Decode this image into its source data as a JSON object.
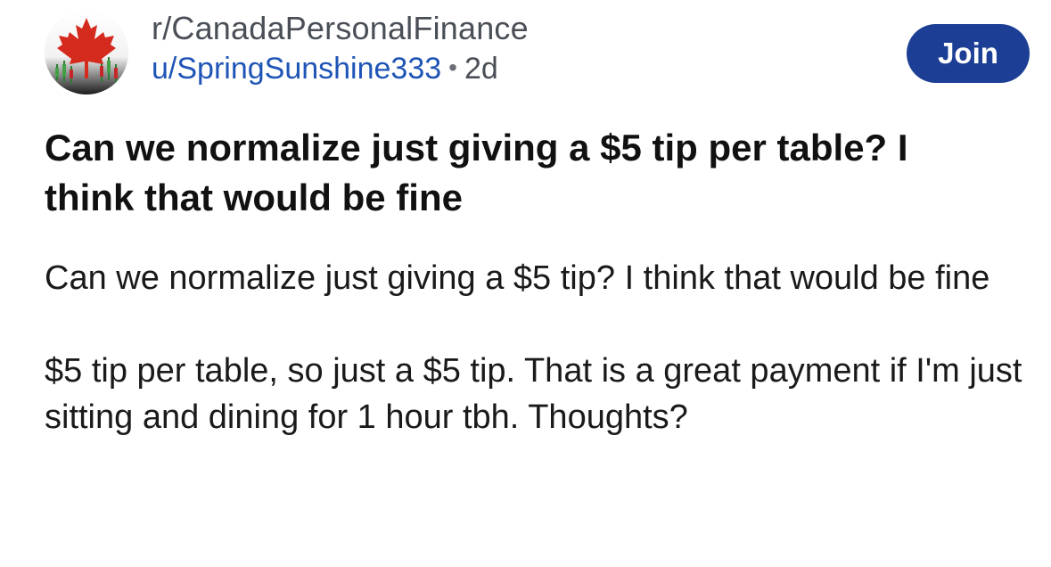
{
  "header": {
    "subreddit": "r/CanadaPersonalFinance",
    "username": "u/SpringSunshine333",
    "separator": "•",
    "age": "2d",
    "join_label": "Join"
  },
  "avatar": {
    "icon": "maple-leaf-icon",
    "leaf_color": "#d52b1e"
  },
  "post": {
    "title": "Can we normalize just giving a $5 tip per table? I think that would be fine",
    "paragraphs": [
      "Can we normalize just giving a $5 tip? I think that would be fine",
      "$5 tip per table, so just a $5 tip. That is a great payment if I'm just sitting and dining for 1 hour tbh. Thoughts?"
    ]
  },
  "colors": {
    "join_button": "#1c3f95",
    "username": "#1f55b6",
    "text": "#1a1a1a"
  }
}
